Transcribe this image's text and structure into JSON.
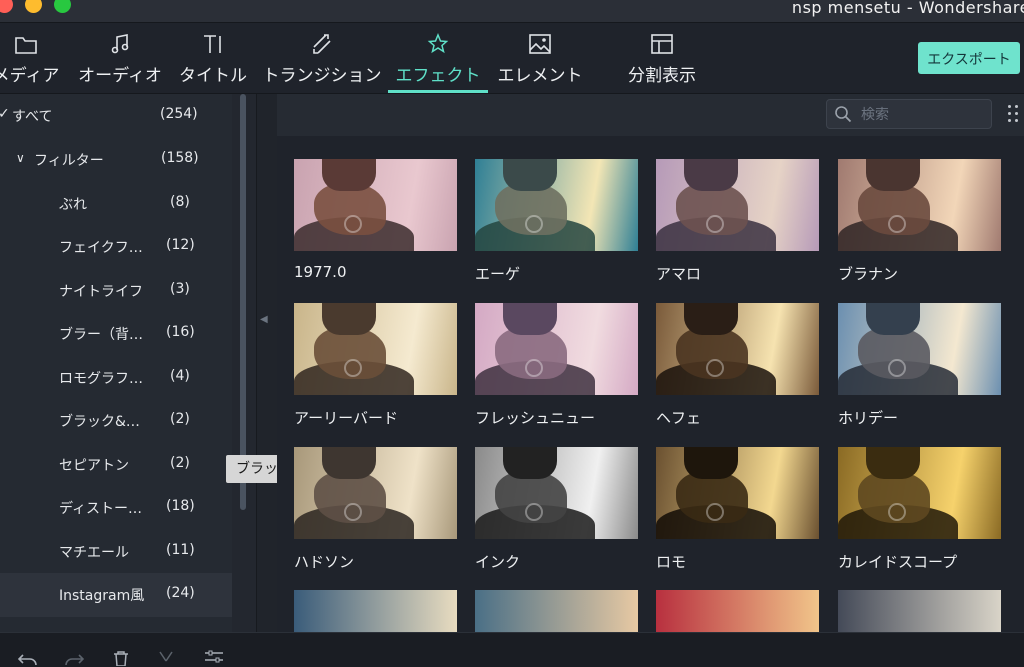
{
  "window": {
    "title": "nsp mensetu - Wondershare"
  },
  "toolbar": {
    "tabs": [
      {
        "label": "メディア",
        "icon": "folder-icon"
      },
      {
        "label": "オーディオ",
        "icon": "music-note-icon"
      },
      {
        "label": "タイトル",
        "icon": "text-icon"
      },
      {
        "label": "トランジション",
        "icon": "transition-icon"
      },
      {
        "label": "エフェクト",
        "icon": "effects-icon",
        "active": true
      },
      {
        "label": "エレメント",
        "icon": "image-icon"
      },
      {
        "label": "分割表示",
        "icon": "split-screen-icon"
      }
    ],
    "export_label": "エクスポート",
    "accent_color": "#5fe0c8"
  },
  "sidebar": {
    "items": [
      {
        "name": "すべて",
        "count": "(254)"
      },
      {
        "name": "フィルター",
        "count": "(158)"
      },
      {
        "name": "ぶれ",
        "count": "(8)"
      },
      {
        "name": "フェイクフ…",
        "count": "(12)"
      },
      {
        "name": "ナイトライフ",
        "count": "(3)"
      },
      {
        "name": "ブラー（背…",
        "count": "(16)"
      },
      {
        "name": "ロモグラフ…",
        "count": "(4)"
      },
      {
        "name": "ブラック&…",
        "count": "(2)"
      },
      {
        "name": "セピアトン",
        "count": "(2)"
      },
      {
        "name": "ディストー…",
        "count": "(18)"
      },
      {
        "name": "マチエール",
        "count": "(11)"
      },
      {
        "name": "Instagram風",
        "count": "(24)"
      }
    ],
    "tooltip": "ブラック＆ホワイト"
  },
  "search": {
    "placeholder": "検索"
  },
  "effects": [
    {
      "name": "1977.0"
    },
    {
      "name": "エーゲ"
    },
    {
      "name": "アマロ"
    },
    {
      "name": "ブラナン"
    },
    {
      "name": "アーリーバード"
    },
    {
      "name": "フレッシュニュー"
    },
    {
      "name": "ヘフェ"
    },
    {
      "name": "ホリデー"
    },
    {
      "name": "ハドソン"
    },
    {
      "name": "インク"
    },
    {
      "name": "ロモ"
    },
    {
      "name": "カレイドスコープ"
    }
  ]
}
